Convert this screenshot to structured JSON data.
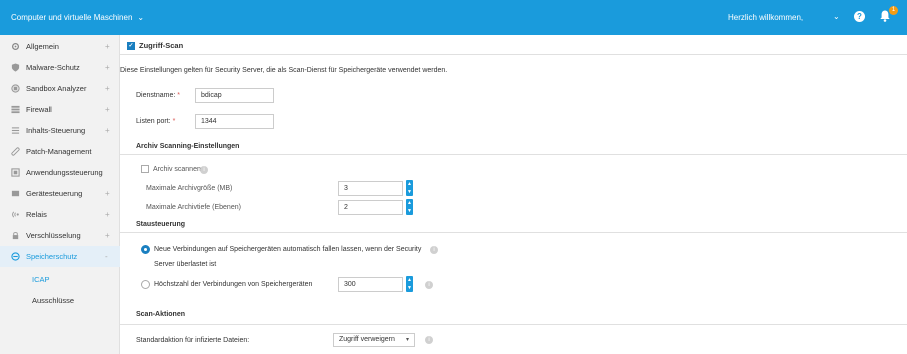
{
  "topbar": {
    "context": "Computer und virtuelle Maschinen",
    "welcome": "Herzlich willkommen,",
    "help_label": "?",
    "badge": "1",
    "bg_color": "#1a9bdc"
  },
  "sidebar": {
    "items": [
      {
        "label": "Allgemein",
        "icon": "gear-icon",
        "expand": "+"
      },
      {
        "label": "Malware-Schutz",
        "icon": "shield-icon",
        "expand": "+"
      },
      {
        "label": "Sandbox Analyzer",
        "icon": "sandbox-icon",
        "expand": "+"
      },
      {
        "label": "Firewall",
        "icon": "firewall-icon",
        "expand": "+"
      },
      {
        "label": "Inhalts-Steuerung",
        "icon": "content-icon",
        "expand": "+"
      },
      {
        "label": "Patch-Management",
        "icon": "patch-icon",
        "expand": ""
      },
      {
        "label": "Anwendungssteuerung",
        "icon": "app-control-icon",
        "expand": ""
      },
      {
        "label": "Gerätesteuerung",
        "icon": "device-icon",
        "expand": "+"
      },
      {
        "label": "Relais",
        "icon": "relay-icon",
        "expand": "+"
      },
      {
        "label": "Verschlüsselung",
        "icon": "lock-icon",
        "expand": "+"
      },
      {
        "label": "Speicherschutz",
        "icon": "storage-icon",
        "expand": "-"
      }
    ],
    "subitems": [
      "ICAP",
      "Ausschlüsse"
    ]
  },
  "main": {
    "header": "Zugriff-Scan",
    "intro": "Diese Einstellungen gelten für Security Server, die als Scan-Dienst für Speichergeräte verwendet werden.",
    "service_name_label": "Dienstname:",
    "service_name_value": "bdicap",
    "listen_port_label": "Listen port:",
    "listen_port_value": "1344",
    "required_mark": "*",
    "archive_section": "Archiv Scanning-Einstellungen",
    "archive_scan_label": "Archiv scannen",
    "max_size_label": "Maximale Archivgröße (MB)",
    "max_size_value": "3",
    "max_depth_label": "Maximale Archivtiefe (Ebenen)",
    "max_depth_value": "2",
    "congestion_section": "Stausteuerung",
    "radio1_line1": "Neue Verbindungen auf Speichergeräten automatisch fallen lassen, wenn der Security",
    "radio1_line2": "Server überlastet ist",
    "radio2_label": "Höchstzahl der Verbindungen von Speichergeräten",
    "radio2_value": "300",
    "scan_actions_section": "Scan-Aktionen",
    "default_action_label": "Standardaktion für infizierte Dateien:",
    "default_action_value": "Zugriff verweigern"
  }
}
